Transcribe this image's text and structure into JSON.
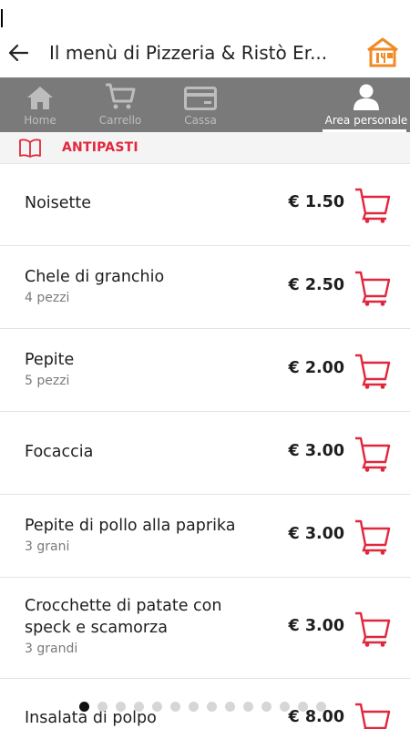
{
  "header": {
    "title": "Il menù di Pizzeria & Ristò Er..."
  },
  "tabs": [
    {
      "label": "Home",
      "icon": "home-icon"
    },
    {
      "label": "Carrello",
      "icon": "cart-icon"
    },
    {
      "label": "Cassa",
      "icon": "credit-card-icon"
    },
    {
      "label": "Area personale",
      "icon": "user-icon",
      "active": true
    }
  ],
  "section": {
    "title": "ANTIPASTI",
    "icon": "book-icon"
  },
  "items": [
    {
      "name": "Noisette",
      "sub": "",
      "price": "€ 1.50"
    },
    {
      "name": "Chele di granchio",
      "sub": "4 pezzi",
      "price": "€ 2.50"
    },
    {
      "name": "Pepite",
      "sub": "5 pezzi",
      "price": "€ 2.00"
    },
    {
      "name": "Focaccia",
      "sub": "",
      "price": "€ 3.00"
    },
    {
      "name": "Pepite di pollo alla paprika",
      "sub": "3 grani",
      "price": "€ 3.00"
    },
    {
      "name": "Crocchette di patate con speck e scamorza",
      "sub": "3 grandi",
      "price": "€ 3.00"
    },
    {
      "name": "Insalata di polpo",
      "sub": "",
      "price": "€ 8.00"
    }
  ],
  "pager": {
    "total": 14,
    "current": 1
  },
  "colors": {
    "accent": "#e0273c",
    "tabbar": "#7a7a7a",
    "home_icon": "#f08a24"
  }
}
